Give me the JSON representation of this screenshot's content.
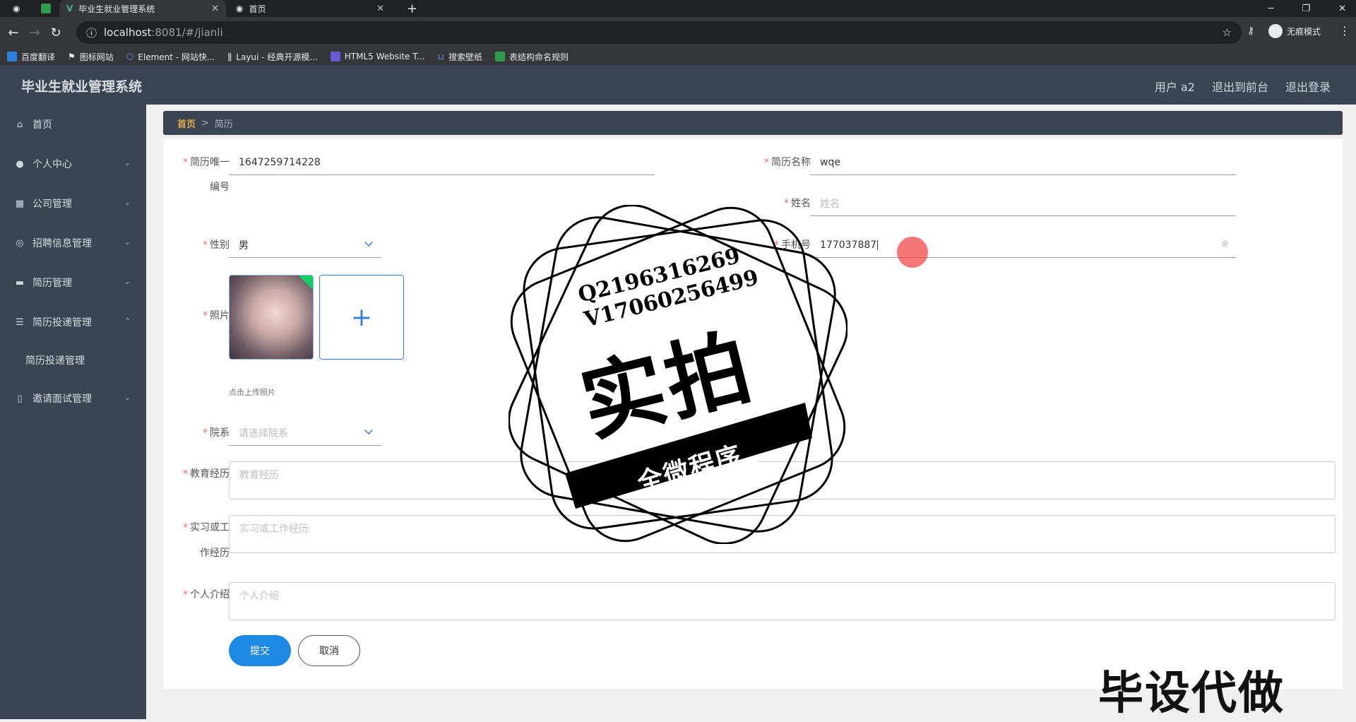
{
  "browser": {
    "tabs": [
      {
        "label": "毕业生就业管理系统",
        "active": true
      },
      {
        "label": "首页",
        "active": false
      }
    ],
    "address": {
      "host": "localhost",
      "port": ":8081/#/jianli"
    },
    "incognito_label": "无痕模式",
    "bookmarks": [
      "百度翻译",
      "图标网站",
      "Element - 网站快...",
      "Layui - 经典开源模...",
      "HTML5 Website T...",
      "搜索壁纸",
      "表结构命名规则"
    ]
  },
  "header": {
    "title": "毕业生就业管理系统",
    "links": [
      "用户 a2",
      "退出到前台",
      "退出登录"
    ]
  },
  "sidebar": {
    "items": [
      {
        "label": "首页",
        "icon": "home-icon",
        "has_chevron": false
      },
      {
        "label": "个人中心",
        "icon": "user-icon",
        "has_chevron": true
      },
      {
        "label": "公司管理",
        "icon": "grid-icon",
        "has_chevron": true
      },
      {
        "label": "招聘信息管理",
        "icon": "compass-icon",
        "has_chevron": true
      },
      {
        "label": "简历管理",
        "icon": "ticket-icon",
        "has_chevron": true
      },
      {
        "label": "简历投递管理",
        "icon": "list-icon",
        "has_chevron": true,
        "expanded": true
      },
      {
        "label": "简历投递管理",
        "sub": true
      },
      {
        "label": "邀请面试管理",
        "icon": "phone-icon",
        "has_chevron": true
      }
    ]
  },
  "breadcrumb": {
    "home": "首页",
    "sep": ">",
    "current": "简历"
  },
  "form": {
    "resume_id_label_1": "简历唯一",
    "resume_id_label_2": "编号",
    "resume_id_value": "1647259714228",
    "resume_name_label": "简历名称",
    "resume_name_value": "wqe",
    "name_label": "姓名",
    "name_placeholder": "姓名",
    "gender_label": "性别",
    "gender_value": "男",
    "phone_label": "手机号",
    "phone_value": "177037887",
    "photo_label": "照片",
    "photo_hint": "点击上传照片",
    "dept_label": "院系",
    "dept_placeholder": "请选择院系",
    "edu_label": "教育经历",
    "edu_placeholder": "教育经历",
    "work_label_1": "实习或工",
    "work_label_2": "作经历",
    "work_placeholder": "实习或工作经历",
    "intro_label": "个人介绍",
    "intro_placeholder": "个人介绍",
    "submit_label": "提交",
    "cancel_label": "取消"
  },
  "watermark": {
    "line1": "Q2196316269",
    "line2": "V17060256499",
    "big": "实拍",
    "ribbon": "全微程序",
    "corner": "毕设代做"
  },
  "colors": {
    "sidebar": "#3a4453",
    "primary": "#1e88e5",
    "required": "#f56c6c",
    "breadcrumb_home": "#e2a94a"
  }
}
